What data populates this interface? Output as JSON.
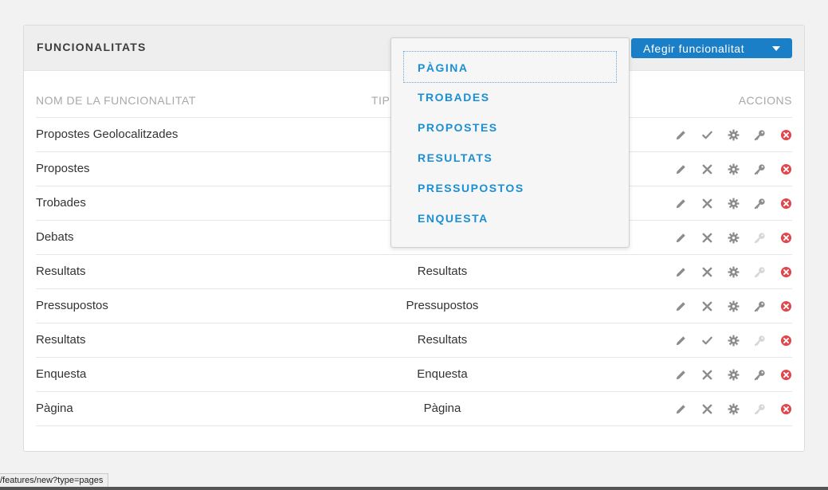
{
  "header": {
    "title": "FUNCIONALITATS",
    "add_button_label": "Afegir funcionalitat"
  },
  "table": {
    "columns": {
      "name": "NOM DE LA FUNCIONALITAT",
      "type": "TIP",
      "actions": "ACCIONS"
    },
    "rows": [
      {
        "name": "Propostes Geolocalitzades",
        "type": "",
        "published": true,
        "permissions": true
      },
      {
        "name": "Propostes",
        "type": "",
        "published": false,
        "permissions": true
      },
      {
        "name": "Trobades",
        "type": "",
        "published": false,
        "permissions": true
      },
      {
        "name": "Debats",
        "type": "",
        "published": false,
        "permissions": false
      },
      {
        "name": "Resultats",
        "type": "Resultats",
        "published": false,
        "permissions": false
      },
      {
        "name": "Pressupostos",
        "type": "Pressupostos",
        "published": false,
        "permissions": true
      },
      {
        "name": "Resultats",
        "type": "Resultats",
        "published": true,
        "permissions": false
      },
      {
        "name": "Enquesta",
        "type": "Enquesta",
        "published": false,
        "permissions": true
      },
      {
        "name": "Pàgina",
        "type": "Pàgina",
        "published": false,
        "permissions": false
      }
    ]
  },
  "dropdown": {
    "items": [
      "PÀGINA",
      "TROBADES",
      "PROPOSTES",
      "RESULTATS",
      "PRESSUPOSTOS",
      "ENQUESTA"
    ],
    "focused_index": 0
  },
  "status_bar": {
    "url": "/features/new?type=pages"
  },
  "colors": {
    "accent": "#1a7fc6",
    "link": "#1a8fd4",
    "icon": "#8c8c8c",
    "icon_disabled": "#d6d6d6",
    "delete": "#e0484d"
  }
}
